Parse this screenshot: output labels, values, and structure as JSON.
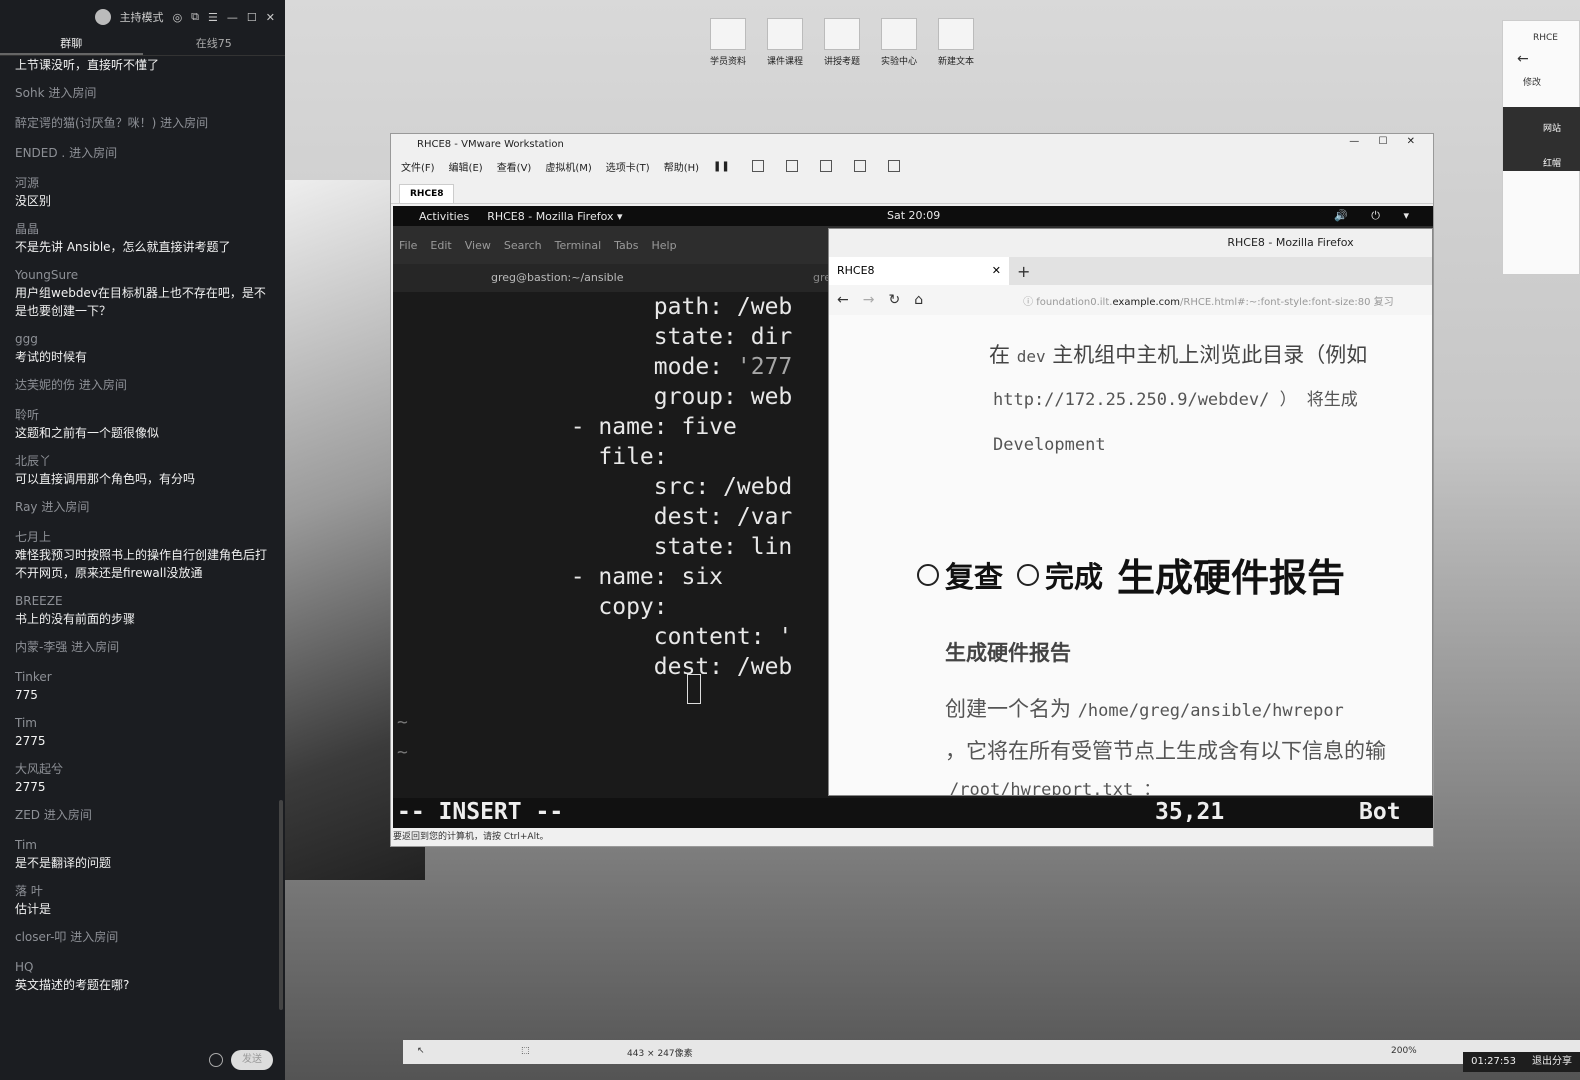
{
  "chat": {
    "mode_label": "主持模式",
    "tab_chat": "群聊",
    "tab_online": "在线75",
    "system_messages_top": "上节课没听，直接听不懂了",
    "items": [
      {
        "type": "sys",
        "text": "Sohk 进入房间"
      },
      {
        "type": "sys",
        "text": "醉定谔的猫(讨厌鱼？咪！) 进入房间"
      },
      {
        "type": "sys",
        "text": "ENDED . 进入房间"
      },
      {
        "type": "msg",
        "user": "河源",
        "text": "没区别"
      },
      {
        "type": "msg",
        "user": "晶晶",
        "text": "不是先讲 Ansible，怎么就直接讲考题了"
      },
      {
        "type": "msg",
        "user": "YoungSure",
        "text": "用户组webdev在目标机器上也不存在吧，是不是也要创建一下？"
      },
      {
        "type": "msg",
        "user": "ggg",
        "text": "考试的时候有"
      },
      {
        "type": "sys",
        "text": "达芙妮的伤 进入房间"
      },
      {
        "type": "msg",
        "user": "聆听",
        "text": "这题和之前有一个题很像似"
      },
      {
        "type": "msg",
        "user": "北辰丫",
        "text": "可以直接调用那个角色吗，有分吗"
      },
      {
        "type": "sys",
        "text": "Ray 进入房间"
      },
      {
        "type": "msg",
        "user": "七月上",
        "text": "难怪我预习时按照书上的操作自行创建角色后打不开网页，原来还是firewall没放通"
      },
      {
        "type": "msg",
        "user": "BREEZE",
        "text": "书上的没有前面的步骤"
      },
      {
        "type": "sys",
        "text": "内蒙-李强 进入房间"
      },
      {
        "type": "msg",
        "user": "Tinker",
        "text": "775"
      },
      {
        "type": "msg",
        "user": "Tim",
        "text": "2775"
      },
      {
        "type": "msg",
        "user": "大风起兮",
        "text": "2775"
      },
      {
        "type": "sys",
        "text": "ZED 进入房间"
      },
      {
        "type": "msg",
        "user": "Tim",
        "text": "是不是翻译的问题"
      },
      {
        "type": "msg",
        "user": "落  叶",
        "text": "估计是"
      },
      {
        "type": "sys",
        "text": "closer-叩    进入房间"
      },
      {
        "type": "msg",
        "user": "HQ",
        "text": "英文描述的考题在哪?"
      }
    ],
    "send_label": "发送"
  },
  "desktop": {
    "icons": [
      "学员资料",
      "课件课程",
      "讲授考题",
      "实验中心",
      "新建文本"
    ],
    "right_panel": {
      "title": "RHCE",
      "item": "修改",
      "dark": "网站",
      "dark2": "红帽"
    }
  },
  "vmware": {
    "title": "RHCE8 - VMware Workstation",
    "menu": [
      "文件(F)",
      "编辑(E)",
      "查看(V)",
      "虚拟机(M)",
      "选项卡(T)",
      "帮助(H)"
    ],
    "tab": "RHCE8",
    "status_hint": "要返回到您的计算机，请按 Ctrl+Alt。"
  },
  "gnome": {
    "activities": "Activities",
    "app": "RHCE8 - Mozilla Firefox ▾",
    "clock": "Sat 20:09",
    "tray": "🔊 ⏻ ▾"
  },
  "terminal": {
    "menu": [
      "File",
      "Edit",
      "View",
      "Search",
      "Terminal",
      "Tabs",
      "Help"
    ],
    "tab_title": "greg@bastion:~/ansible",
    "tab2": "gre",
    "lines": [
      {
        "indent": "        ",
        "key": "path:",
        "val": " /web"
      },
      {
        "indent": "        ",
        "key": "state:",
        "val": " dir"
      },
      {
        "indent": "        ",
        "key": "mode:",
        "val": " '277",
        "quoted": true
      },
      {
        "indent": "        ",
        "key": "group:",
        "val": " web"
      },
      {
        "indent": "  - ",
        "key": "name:",
        "val": " five"
      },
      {
        "indent": "    ",
        "key": "file:",
        "val": ""
      },
      {
        "indent": "        ",
        "key": "src:",
        "val": " /webd"
      },
      {
        "indent": "        ",
        "key": "dest:",
        "val": " /var"
      },
      {
        "indent": "        ",
        "key": "state:",
        "val": " lin"
      },
      {
        "indent": "  - ",
        "key": "name:",
        "val": " six"
      },
      {
        "indent": "    ",
        "key": "copy:",
        "val": ""
      },
      {
        "indent": "        ",
        "key": "content:",
        "val": " '"
      },
      {
        "indent": "        ",
        "key": "dest:",
        "val": " /web"
      }
    ],
    "tilde": "~",
    "mode": "-- INSERT --",
    "position": "35,21",
    "scroll": "Bot"
  },
  "firefox": {
    "title": "RHCE8 - Mozilla Firefox",
    "tab": "RHCE8",
    "url_pre": "foundation0.ilt.",
    "url_domain": "example.com",
    "url_post": "/RHCE.html#:~:font-style:font-size:80 复习",
    "p1_a": "在 ",
    "p1_code": "dev",
    "p1_b": " 主机组中主机上浏览此目录（例如",
    "p2": "http://172.25.250.9/webdev/ ） 将生成",
    "p3": "Development",
    "radio1": "复查",
    "radio2": "完成",
    "heading": "生成硬件报告",
    "subheading": "生成硬件报告",
    "p4_a": "创建一个名为 ",
    "p4_code": "/home/greg/ansible/hwrepor",
    "p5": "，它将在所有受管节点上生成含有以下信息的输",
    "p6": "/root/hwreport.txt  ："
  },
  "bottom": {
    "size": "443 × 247像素",
    "zoom": "200%",
    "time": "01:27:53",
    "exit": "退出分享"
  }
}
